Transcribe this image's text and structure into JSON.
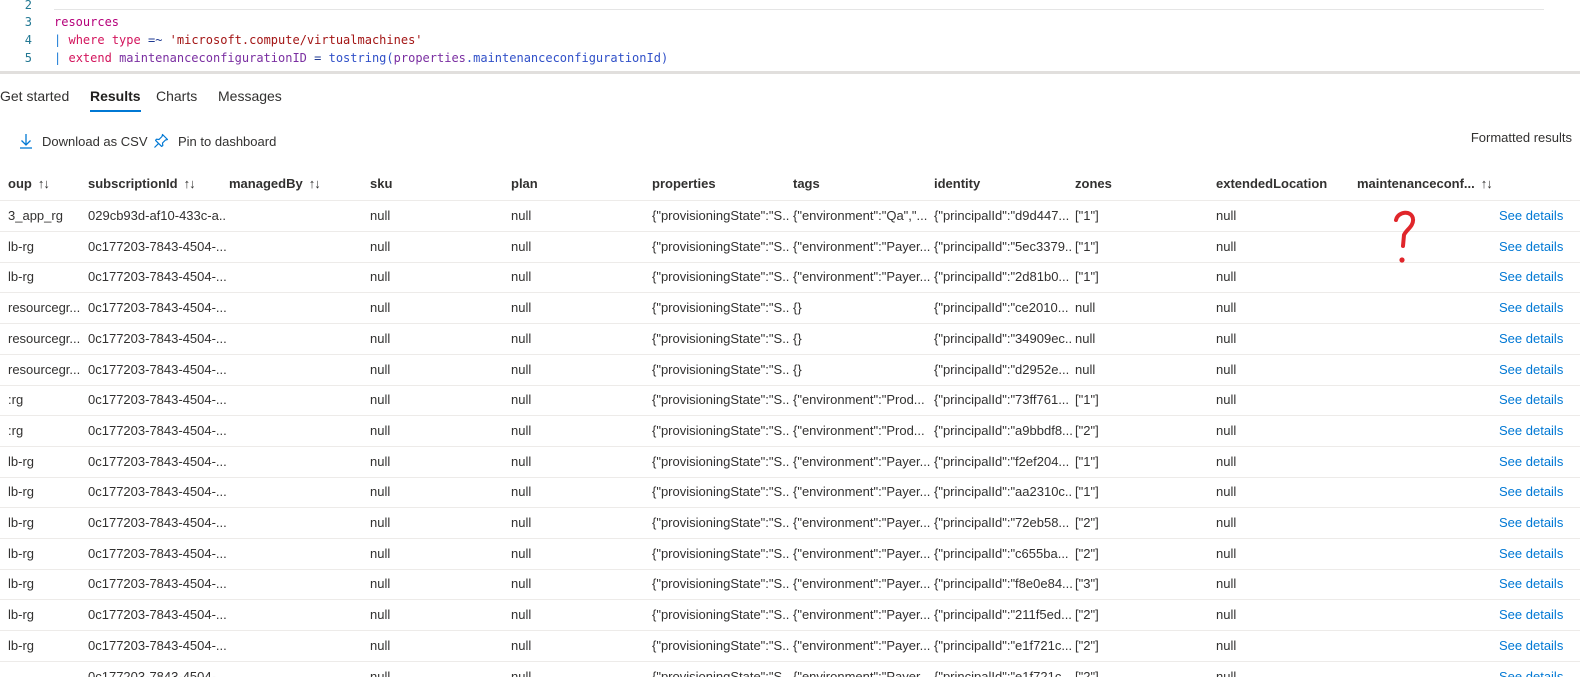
{
  "editor": {
    "lines": [
      {
        "num": "2"
      },
      {
        "num": "3",
        "t1": "resources"
      },
      {
        "num": "4",
        "pipe": "|",
        "kw": "where",
        "t2": "type",
        "op": "=~",
        "str": "'microsoft.compute/virtualmachines'"
      },
      {
        "num": "5",
        "pipe": "|",
        "kw": "extend",
        "t2": "maintenanceconfigurationID",
        "op": "=",
        "fn": "tostring(",
        "prop": "properties",
        "rest": ".maintenanceconfigurationId)"
      }
    ]
  },
  "tabs": [
    {
      "label": "Get started"
    },
    {
      "label": "Results"
    },
    {
      "label": "Charts"
    },
    {
      "label": "Messages"
    }
  ],
  "toolbar": {
    "download_label": "Download as CSV",
    "pin_label": "Pin to dashboard",
    "formatted_label": "Formatted results"
  },
  "grid": {
    "columns": [
      "oup",
      "subscriptionId",
      "managedBy",
      "sku",
      "plan",
      "properties",
      "tags",
      "identity",
      "zones",
      "extendedLocation",
      "maintenanceconf..."
    ],
    "sortable": [
      true,
      true,
      true,
      false,
      false,
      false,
      false,
      false,
      false,
      false,
      true
    ],
    "sort_glyph": "↑↓",
    "details_label": "See details",
    "rows": [
      [
        "3_app_rg",
        "029cb93d-af10-433c-a...",
        "",
        "null",
        "null",
        "{\"provisioningState\":\"S...",
        "{\"environment\":\"Qa\",\"...",
        "{\"principalId\":\"d9d447...",
        "[\"1\"]",
        "null",
        ""
      ],
      [
        "lb-rg",
        "0c177203-7843-4504-...",
        "",
        "null",
        "null",
        "{\"provisioningState\":\"S...",
        "{\"environment\":\"Payer...",
        "{\"principalId\":\"5ec3379...",
        "[\"1\"]",
        "null",
        ""
      ],
      [
        "lb-rg",
        "0c177203-7843-4504-...",
        "",
        "null",
        "null",
        "{\"provisioningState\":\"S...",
        "{\"environment\":\"Payer...",
        "{\"principalId\":\"2d81b0...",
        "[\"1\"]",
        "null",
        ""
      ],
      [
        "resourcegr...",
        "0c177203-7843-4504-...",
        "",
        "null",
        "null",
        "{\"provisioningState\":\"S...",
        "{}",
        "{\"principalId\":\"ce2010...",
        "null",
        "null",
        ""
      ],
      [
        "resourcegr...",
        "0c177203-7843-4504-...",
        "",
        "null",
        "null",
        "{\"provisioningState\":\"S...",
        "{}",
        "{\"principalId\":\"34909ec...",
        "null",
        "null",
        ""
      ],
      [
        "resourcegr...",
        "0c177203-7843-4504-...",
        "",
        "null",
        "null",
        "{\"provisioningState\":\"S...",
        "{}",
        "{\"principalId\":\"d2952e...",
        "null",
        "null",
        ""
      ],
      [
        ":rg",
        "0c177203-7843-4504-...",
        "",
        "null",
        "null",
        "{\"provisioningState\":\"S...",
        "{\"environment\":\"Prod...",
        "{\"principalId\":\"73ff761...",
        "[\"1\"]",
        "null",
        ""
      ],
      [
        ":rg",
        "0c177203-7843-4504-...",
        "",
        "null",
        "null",
        "{\"provisioningState\":\"S...",
        "{\"environment\":\"Prod...",
        "{\"principalId\":\"a9bbdf8...",
        "[\"2\"]",
        "null",
        ""
      ],
      [
        "lb-rg",
        "0c177203-7843-4504-...",
        "",
        "null",
        "null",
        "{\"provisioningState\":\"S...",
        "{\"environment\":\"Payer...",
        "{\"principalId\":\"f2ef204...",
        "[\"1\"]",
        "null",
        ""
      ],
      [
        "lb-rg",
        "0c177203-7843-4504-...",
        "",
        "null",
        "null",
        "{\"provisioningState\":\"S...",
        "{\"environment\":\"Payer...",
        "{\"principalId\":\"aa2310c...",
        "[\"1\"]",
        "null",
        ""
      ],
      [
        "lb-rg",
        "0c177203-7843-4504-...",
        "",
        "null",
        "null",
        "{\"provisioningState\":\"S...",
        "{\"environment\":\"Payer...",
        "{\"principalId\":\"72eb58...",
        "[\"2\"]",
        "null",
        ""
      ],
      [
        "lb-rg",
        "0c177203-7843-4504-...",
        "",
        "null",
        "null",
        "{\"provisioningState\":\"S...",
        "{\"environment\":\"Payer...",
        "{\"principalId\":\"c655ba...",
        "[\"2\"]",
        "null",
        ""
      ],
      [
        "lb-rg",
        "0c177203-7843-4504-...",
        "",
        "null",
        "null",
        "{\"provisioningState\":\"S...",
        "{\"environment\":\"Payer...",
        "{\"principalId\":\"f8e0e84...",
        "[\"3\"]",
        "null",
        ""
      ],
      [
        "lb-rg",
        "0c177203-7843-4504-...",
        "",
        "null",
        "null",
        "{\"provisioningState\":\"S...",
        "{\"environment\":\"Payer...",
        "{\"principalId\":\"211f5ed...",
        "[\"2\"]",
        "null",
        ""
      ],
      [
        "lb-rg",
        "0c177203-7843-4504-...",
        "",
        "null",
        "null",
        "{\"provisioningState\":\"S...",
        "{\"environment\":\"Payer...",
        "{\"principalId\":\"e1f721c...",
        "[\"2\"]",
        "null",
        ""
      ]
    ]
  },
  "annotation": {
    "color": "#e0262b"
  }
}
